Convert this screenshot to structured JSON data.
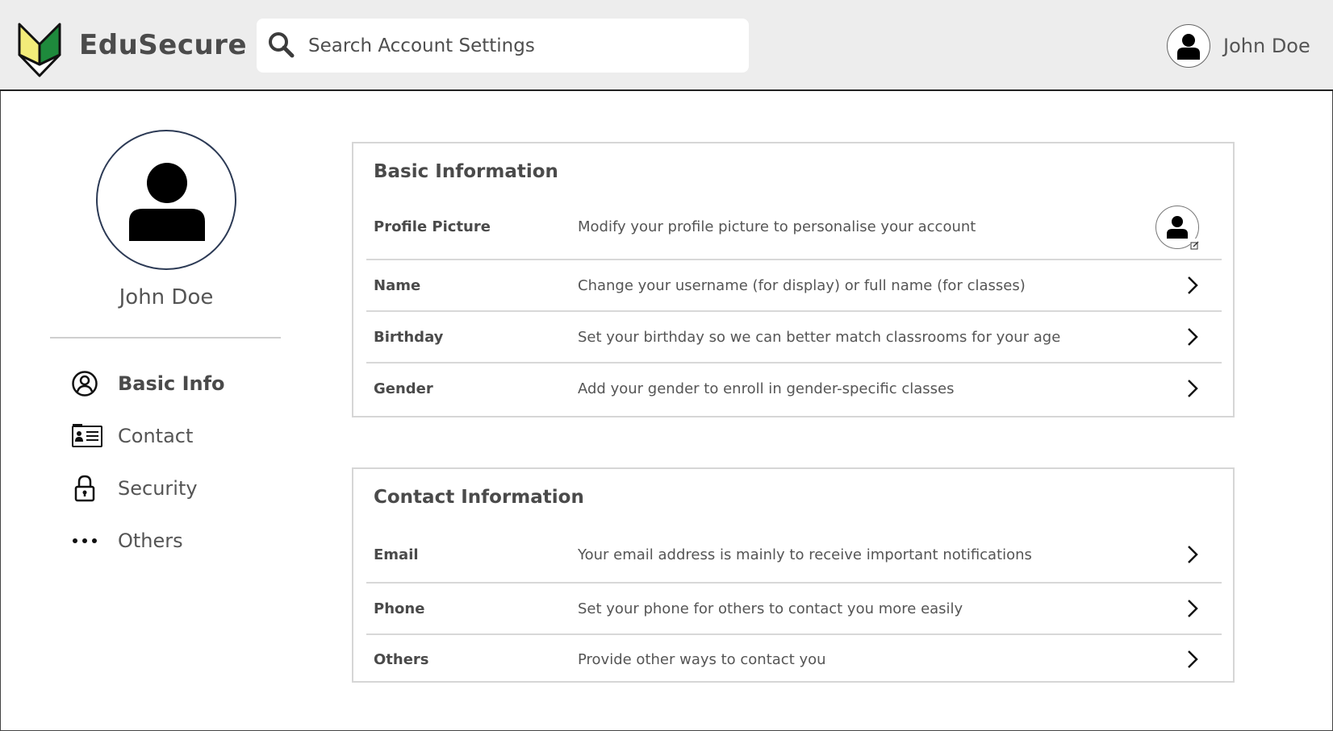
{
  "header": {
    "brand": "EduSecure",
    "search_placeholder": "Search Account Settings",
    "user_name": "John Doe"
  },
  "sidebar": {
    "profile_name": "John Doe",
    "items": [
      {
        "label": "Basic Info",
        "icon": "user-circle-icon",
        "active": true
      },
      {
        "label": "Contact",
        "icon": "id-card-icon",
        "active": false
      },
      {
        "label": "Security",
        "icon": "lock-icon",
        "active": false
      },
      {
        "label": "Others",
        "icon": "more-dots-icon",
        "active": false
      }
    ]
  },
  "basic": {
    "title": "Basic Information",
    "rows": [
      {
        "label": "Profile Picture",
        "desc": "Modify your profile picture to personalise your account"
      },
      {
        "label": "Name",
        "desc": "Change your username (for display) or full name (for classes)"
      },
      {
        "label": "Birthday",
        "desc": "Set your birthday so we can better match classrooms for your age"
      },
      {
        "label": "Gender",
        "desc": "Add your gender to enroll in gender-specific classes"
      }
    ]
  },
  "contact": {
    "title": "Contact Information",
    "rows": [
      {
        "label": "Email",
        "desc": "Your email address is mainly to receive important notifications"
      },
      {
        "label": "Phone",
        "desc": "Set your phone for others to contact you more easily"
      },
      {
        "label": "Others",
        "desc": "Provide other ways to contact you"
      }
    ]
  },
  "colors": {
    "logo_green": "#1e8a3c",
    "logo_yellow": "#f3ec79",
    "header_bg": "#ededed",
    "avatar_ring": "#2c3a55"
  }
}
